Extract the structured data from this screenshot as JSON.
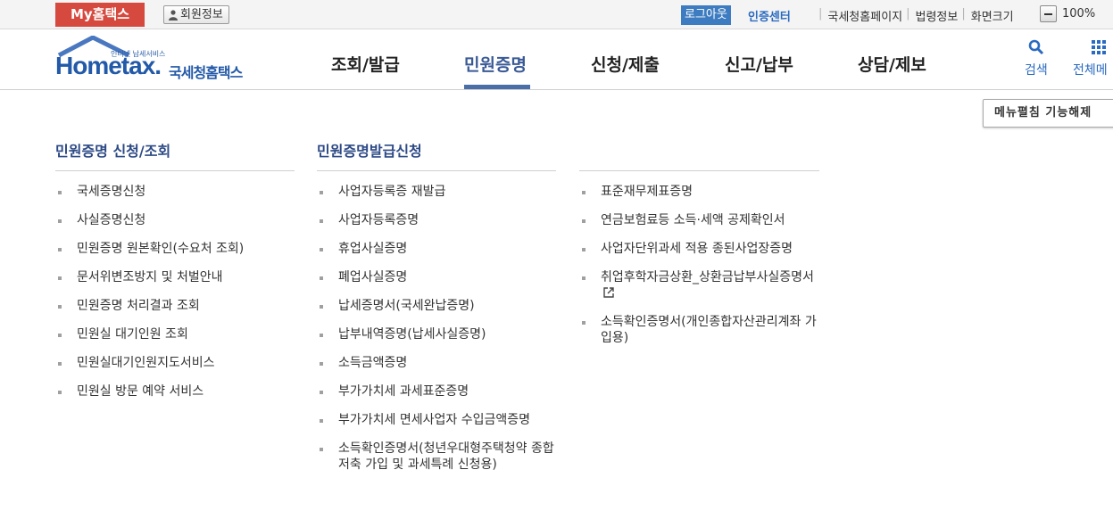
{
  "topbar": {
    "my_hometax": "My홈택스",
    "member_info": "회원정보",
    "logout": "로그아웃",
    "cert_center": "인증센터",
    "links": [
      "국세청홈페이지",
      "법령정보",
      "화면크기"
    ],
    "zoom_value": "100%"
  },
  "header": {
    "logo_sub": "인터넷 납세서비스",
    "logo_main": "Hometax.",
    "logo_kor": "국세청홈택스",
    "nav": [
      "조회/발급",
      "민원증명",
      "신청/제출",
      "신고/납부",
      "상담/제보"
    ],
    "active_nav": "민원증명",
    "search_label": "검색",
    "allmenu_label": "전체메"
  },
  "fold_button": "메뉴펼침 기능해제",
  "columns": [
    {
      "title": "민원증명 신청/조회",
      "items": [
        "국세증명신청",
        "사실증명신청",
        "민원증명 원본확인(수요처 조회)",
        "문서위변조방지 및 처벌안내",
        "민원증명 처리결과 조회",
        "민원실 대기인원 조회",
        "민원실대기인원지도서비스",
        "민원실 방문 예약 서비스"
      ]
    },
    {
      "title": "민원증명발급신청",
      "items": [
        "사업자등록증 재발급",
        "사업자등록증명",
        "휴업사실증명",
        "폐업사실증명",
        "납세증명서(국세완납증명)",
        "납부내역증명(납세사실증명)",
        "소득금액증명",
        "부가가치세 과세표준증명",
        "부가가치세 면세사업자 수입금액증명",
        "소득확인증명서(청년우대형주택청약 종합저축 가입 및 과세특례 신청용)"
      ]
    },
    {
      "title": "",
      "items": [
        "표준재무제표증명",
        "연금보험료등 소득·세액 공제확인서",
        "사업자단위과세 적용 종된사업장증명",
        "취업후학자금상환_상환금납부사실증명서",
        "소득확인증명서(개인종합자산관리계좌 가입용)"
      ]
    }
  ],
  "colors": {
    "brand_red": "#d6493f",
    "brand_blue": "#2259a8",
    "column_title": "#2d4a86"
  }
}
